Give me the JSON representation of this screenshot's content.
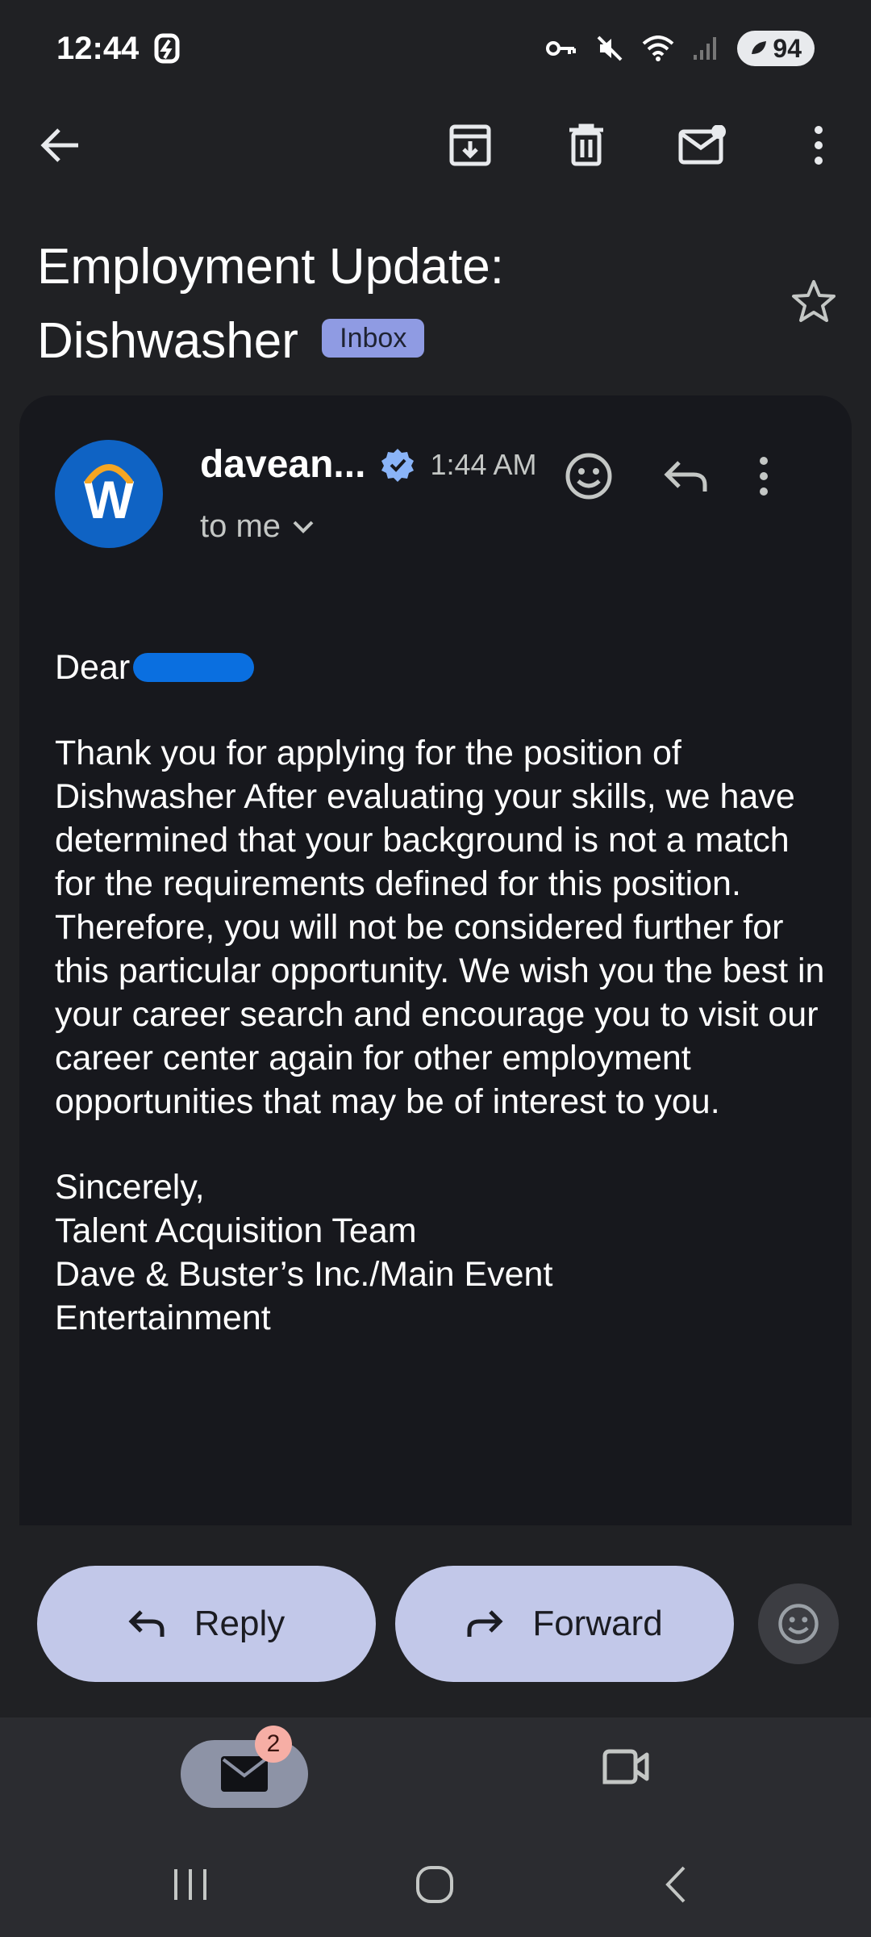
{
  "status_bar": {
    "time": "12:44",
    "battery": "94"
  },
  "email": {
    "subject": "Employment Update: Dishwasher",
    "label": "Inbox",
    "sender": "davean...",
    "time": "1:44 AM",
    "recipient": "to me",
    "avatar_letter": "W",
    "greeting": "Dear",
    "paragraphs": [
      "Thank you for applying for the position of Dishwasher After evaluating your skills, we have determined that your background is not a match for the requirements defined for this position. Therefore, you will not be considered further for this particular opportunity. We wish you the best in your career search and encourage you to visit our career center again for other employment opportunities that may be of interest to you."
    ],
    "signoff": "Sincerely,",
    "signature": [
      "Talent Acquisition Team",
      "Dave & Buster’s Inc./Main Event",
      "Entertainment"
    ]
  },
  "actions": {
    "reply_label": "Reply",
    "forward_label": "Forward"
  },
  "bottom_nav": {
    "mail_badge": "2"
  },
  "colors": {
    "background": "#202124",
    "card": "#17181d",
    "pill": "#c2c8e9",
    "badge": "#8f9be3",
    "avatar": "#0f63c4",
    "verified": "#8ab4f8"
  },
  "icons": [
    "back-arrow-icon",
    "archive-icon",
    "trash-icon",
    "mark-unread-icon",
    "more-vert-icon",
    "star-icon",
    "verified-icon",
    "emoji-icon",
    "reply-icon",
    "forward-icon",
    "mail-icon",
    "video-icon"
  ]
}
